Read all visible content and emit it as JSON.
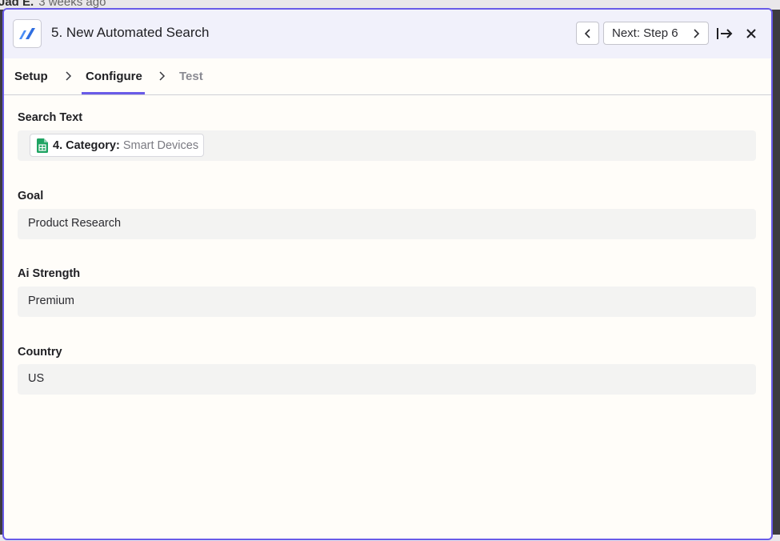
{
  "background": {
    "author": "Jad E.",
    "time": "3 weeks ago"
  },
  "header": {
    "app_logo": "automation-app-logo",
    "title": "5. New Automated Search",
    "prev_icon": "chevron-left-icon",
    "next_label": "Next: Step 6",
    "next_icon": "chevron-right-icon",
    "exit_icon": "exit-arrow-icon",
    "close_icon": "close-icon"
  },
  "tabs": [
    {
      "label": "Setup",
      "state": "done"
    },
    {
      "label": "Configure",
      "state": "active"
    },
    {
      "label": "Test",
      "state": "disabled"
    }
  ],
  "fields": {
    "search_text": {
      "label": "Search Text",
      "pill": {
        "icon": "google-sheets-icon",
        "step_ref": "4. Category:",
        "value": "Smart Devices"
      }
    },
    "goal": {
      "label": "Goal",
      "value": "Product Research"
    },
    "ai_strength": {
      "label": "Ai Strength",
      "value": "Premium"
    },
    "country": {
      "label": "Country",
      "value": "US"
    }
  },
  "colors": {
    "accent": "#695be8",
    "header_bg": "#f1f1fb",
    "input_bg": "#f3f3f2",
    "sheets_green": "#1fa463"
  }
}
